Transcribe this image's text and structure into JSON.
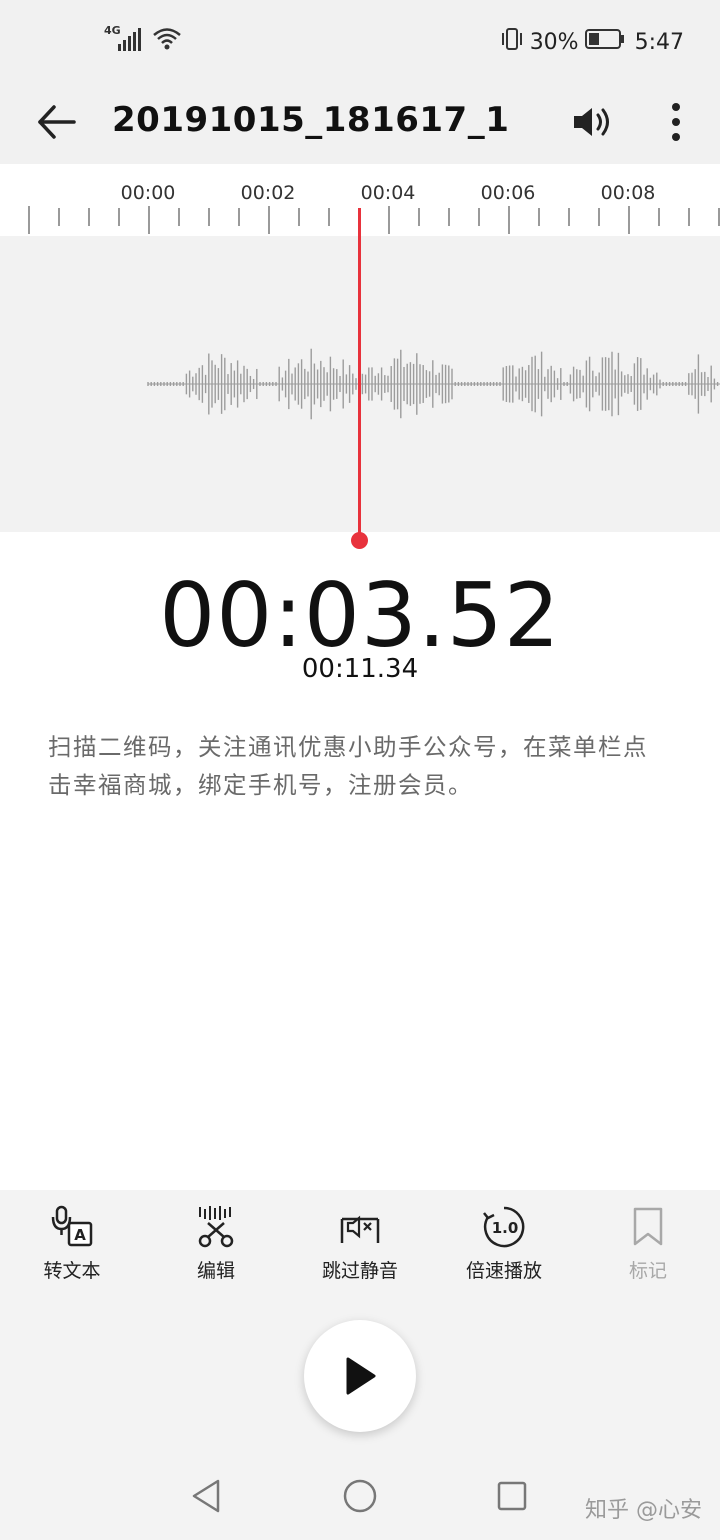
{
  "status_bar": {
    "network": "4G",
    "battery": "30%",
    "time": "5:47",
    "icons": [
      "signal-icon",
      "wifi-icon",
      "vibrate-icon",
      "battery-icon"
    ]
  },
  "app_bar": {
    "title": "20191015_181617_1",
    "icons": [
      "back-arrow-icon",
      "volume-icon",
      "more-vertical-icon"
    ]
  },
  "timeline": {
    "tick_labels": [
      "00:00",
      "00:02",
      "00:04",
      "00:06",
      "00:08"
    ]
  },
  "player": {
    "current_time": "00:03.52",
    "total_time": "00:11.34"
  },
  "transcript": {
    "text": "扫描二维码，关注通讯优惠小助手公众号，在菜单栏点击幸福商城，绑定手机号，注册会员。"
  },
  "toolbar": {
    "items": [
      {
        "label": "转文本",
        "icon": "speech-to-text-icon",
        "enabled": true
      },
      {
        "label": "编辑",
        "icon": "scissors-edit-icon",
        "enabled": true
      },
      {
        "label": "跳过静音",
        "icon": "skip-silence-icon",
        "enabled": true
      },
      {
        "label": "倍速播放",
        "icon": "playback-speed-icon",
        "enabled": true
      },
      {
        "label": "标记",
        "icon": "bookmark-icon",
        "enabled": false
      }
    ],
    "speed_badge": "1.0"
  },
  "watermark": "知乎 @心安",
  "colors": {
    "accent": "#e8323c",
    "background": "#f1f1f1",
    "wave": "#9c9c9c"
  }
}
